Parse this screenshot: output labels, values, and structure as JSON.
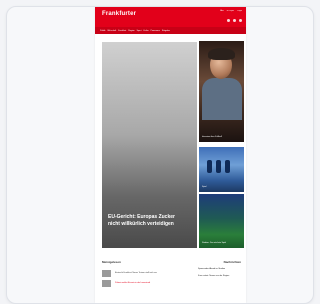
{
  "brand": {
    "name": "Frankfurter",
    "accent": "#e2001a",
    "accent_dark": "#c80016"
  },
  "header": {
    "top_links": [
      "Abo",
      "E-Paper",
      "Login"
    ],
    "utility_icons": [
      "search-icon",
      "user-icon",
      "menu-icon"
    ]
  },
  "nav": {
    "items": [
      "Politik",
      "Wirtschaft",
      "Frankfurt",
      "Region",
      "Sport",
      "Kultur",
      "Panorama",
      "Ratgeber"
    ]
  },
  "hero": {
    "headline": "EU-Gericht: Europas Zucker nicht willkürlich verteidigen"
  },
  "tiles": [
    {
      "caption": "Interview über Fußball"
    },
    {
      "caption": "Spiel"
    },
    {
      "caption": "Stadion: Das nächste Spiel"
    }
  ],
  "list": {
    "left_title": "Meistgelesen",
    "right_title": "Nachrichten",
    "rows": [
      {
        "text": "Eintracht Frankfurt: Neuer Trainer stellt sich vor"
      },
      {
        "text": "Polizei meldet Einsatz in der Innenstadt"
      }
    ],
    "right_items": [
      {
        "text": "Spannender Abend im Stadion"
      },
      {
        "text": "Kurz notiert: Neues aus der Region"
      }
    ]
  }
}
